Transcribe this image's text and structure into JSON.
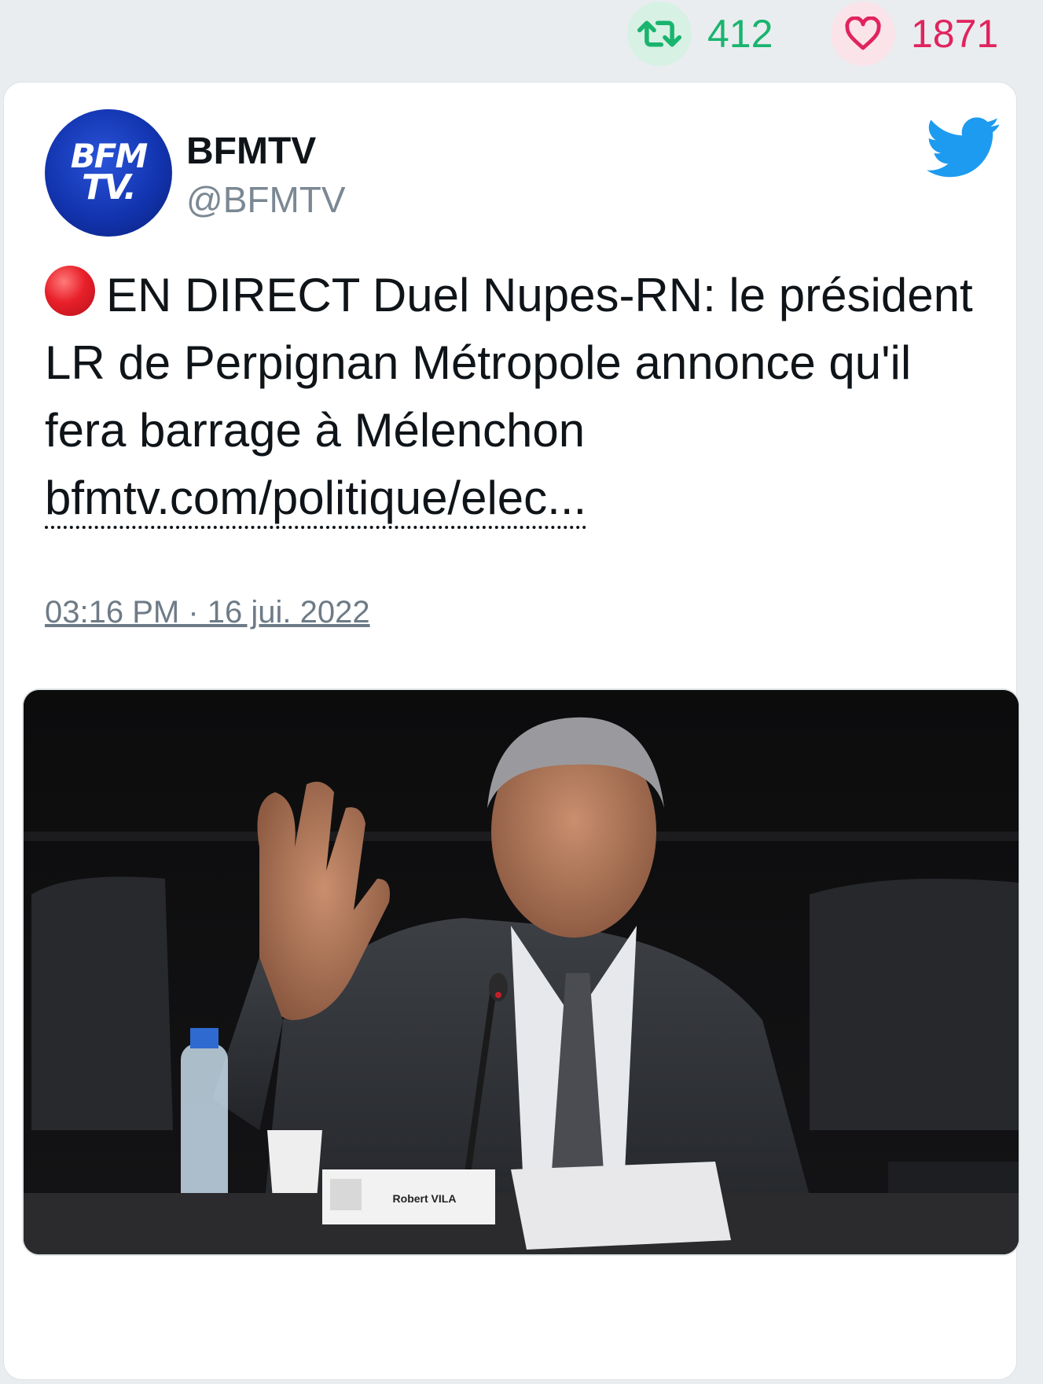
{
  "stats": {
    "retweets": "412",
    "likes": "1871"
  },
  "author": {
    "name": "BFMTV",
    "handle": "@BFMTV",
    "avatar_text_1": "BFM",
    "avatar_text_2": "TV."
  },
  "tweet": {
    "text": "EN DIRECT Duel Nupes-RN: le président LR de Perpignan Métropole annonce qu'il fera barrage à Mélenchon",
    "link": "bfmtv.com/politique/elec...",
    "timestamp": "03:16 PM · 16 jui. 2022"
  },
  "media": {
    "nameplate": "Robert VILA"
  },
  "colors": {
    "retweet": "#19b46e",
    "like": "#e0245e",
    "twitter_blue": "#1d9bf0"
  },
  "icons": [
    "retweet-icon",
    "heart-icon",
    "twitter-bird-icon",
    "reply-icon",
    "retweet-icon",
    "heart-icon"
  ]
}
